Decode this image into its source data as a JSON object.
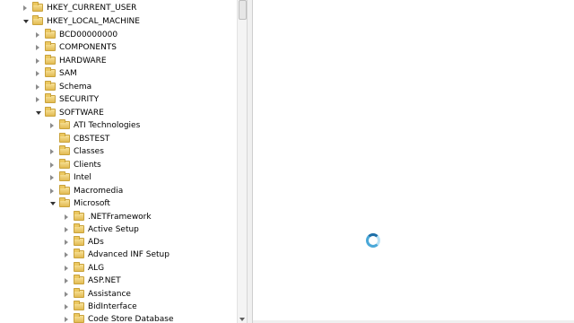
{
  "tree": [
    {
      "label": "HKEY_CURRENT_USER",
      "state": "collapsed"
    },
    {
      "label": "HKEY_LOCAL_MACHINE",
      "state": "expanded"
    },
    {
      "label": "BCD00000000",
      "state": "collapsed"
    },
    {
      "label": "COMPONENTS",
      "state": "collapsed"
    },
    {
      "label": "HARDWARE",
      "state": "collapsed"
    },
    {
      "label": "SAM",
      "state": "collapsed"
    },
    {
      "label": "Schema",
      "state": "collapsed"
    },
    {
      "label": "SECURITY",
      "state": "collapsed"
    },
    {
      "label": "SOFTWARE",
      "state": "expanded"
    },
    {
      "label": "ATI Technologies",
      "state": "collapsed"
    },
    {
      "label": "CBSTEST",
      "state": "none"
    },
    {
      "label": "Classes",
      "state": "collapsed"
    },
    {
      "label": "Clients",
      "state": "collapsed"
    },
    {
      "label": "Intel",
      "state": "collapsed"
    },
    {
      "label": "Macromedia",
      "state": "collapsed"
    },
    {
      "label": "Microsoft",
      "state": "expanded"
    },
    {
      "label": ".NETFramework",
      "state": "collapsed"
    },
    {
      "label": "Active Setup",
      "state": "collapsed"
    },
    {
      "label": "ADs",
      "state": "collapsed"
    },
    {
      "label": "Advanced INF Setup",
      "state": "collapsed"
    },
    {
      "label": "ALG",
      "state": "collapsed"
    },
    {
      "label": "ASP.NET",
      "state": "collapsed"
    },
    {
      "label": "Assistance",
      "state": "collapsed"
    },
    {
      "label": "BidInterface",
      "state": "collapsed"
    },
    {
      "label": "Code Store Database",
      "state": "collapsed"
    }
  ],
  "icons": {
    "folder": "folder-icon",
    "expander_collapsed": "chevron-right-icon",
    "expander_expanded": "chevron-down-icon",
    "busy": "busy-cursor-icon"
  },
  "colors": {
    "folder": "#e8c45a",
    "busy_cursor": "#4aa8d8"
  }
}
